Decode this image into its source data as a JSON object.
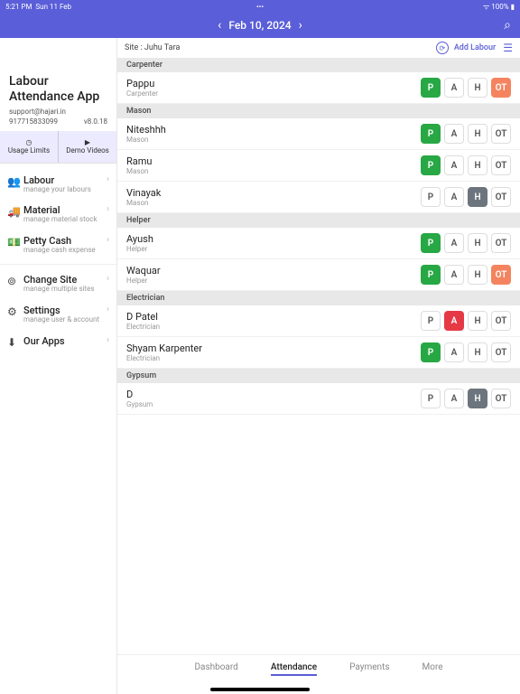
{
  "status": {
    "time": "5:21 PM",
    "day": "Sun 11 Feb",
    "dots": "•••",
    "wifi": "100%"
  },
  "appbar": {
    "date": "Feb 10, 2024"
  },
  "brand": {
    "title1": "Labour",
    "title2": "Attendance App",
    "email": "support@hajari.in",
    "phone": "917715833099",
    "version": "v8.0.18"
  },
  "tabs2": {
    "usage": "Usage Limits",
    "demo": "Demo Videos"
  },
  "menu": {
    "labour": {
      "t": "Labour",
      "s": "manage your labours"
    },
    "material": {
      "t": "Material",
      "s": "manage material stock"
    },
    "petty": {
      "t": "Petty Cash",
      "s": "manage cash expense"
    },
    "change": {
      "t": "Change Site",
      "s": "manage multiple sites"
    },
    "settings": {
      "t": "Settings",
      "s": "manage user & account"
    },
    "ourapps": {
      "t": "Our Apps",
      "s": ""
    }
  },
  "main": {
    "site": "Site : Juhu Tara",
    "addlabour": "Add Labour",
    "sections": {
      "carpenter": "Carpenter",
      "mason": "Mason",
      "helper": "Helper",
      "electrician": "Electrician",
      "gypsum": "Gypsum"
    },
    "people": {
      "pappu": {
        "n": "Pappu",
        "r": "Carpenter"
      },
      "niteshhh": {
        "n": "Niteshhh",
        "r": "Mason"
      },
      "ramu": {
        "n": "Ramu",
        "r": "Mason"
      },
      "vinayak": {
        "n": "Vinayak",
        "r": "Mason"
      },
      "ayush": {
        "n": "Ayush",
        "r": "Helper"
      },
      "waquar": {
        "n": "Waquar",
        "r": "Helper"
      },
      "dpatel": {
        "n": "D Patel",
        "r": "Electrician"
      },
      "shyam": {
        "n": "Shyam Karpenter",
        "r": "Electrician"
      },
      "d": {
        "n": "D",
        "r": "Gypsum"
      }
    },
    "marks": {
      "p": "P",
      "a": "A",
      "h": "H",
      "ot": "OT"
    }
  },
  "bottom": {
    "dashboard": "Dashboard",
    "attendance": "Attendance",
    "payments": "Payments",
    "more": "More"
  }
}
